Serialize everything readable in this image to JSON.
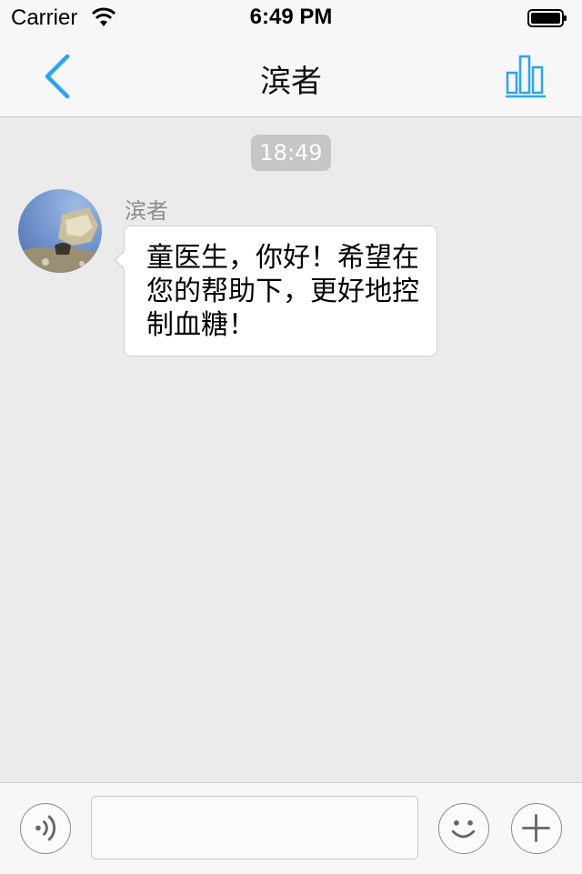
{
  "status_bar": {
    "carrier": "Carrier",
    "time": "6:49 PM",
    "icons": [
      "wifi-icon",
      "battery-icon"
    ]
  },
  "nav": {
    "title": "滨者",
    "back_icon": "chevron-left-icon",
    "stats_icon": "bar-chart-icon",
    "accent_color": "#2aa6ee"
  },
  "chat": {
    "timestamp": "18:49",
    "messages": [
      {
        "sender": "滨者",
        "avatar": "avatar-photo",
        "text": "童医生，你好！希望在您的帮助下，更好地控制血糖！"
      }
    ]
  },
  "input_bar": {
    "voice_icon": "voice-icon",
    "text_value": "",
    "emoji_icon": "emoji-icon",
    "plus_icon": "plus-icon"
  }
}
